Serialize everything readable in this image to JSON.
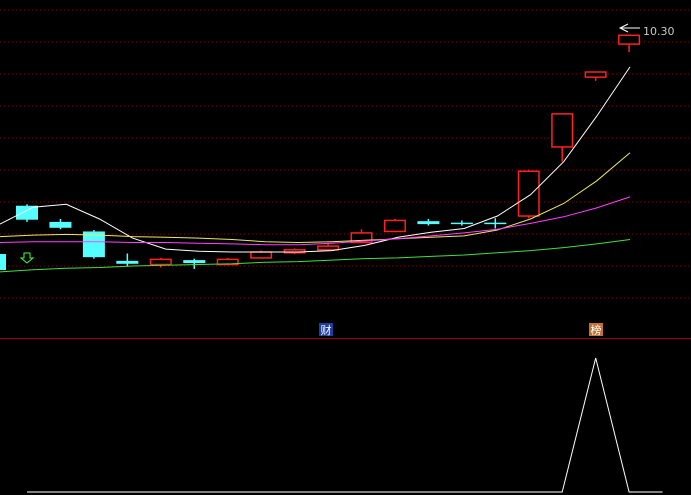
{
  "header": {
    "price_label": "10.30"
  },
  "markers": {
    "finance_badge": "财",
    "ranking_badge": "榜"
  },
  "colors": {
    "background": "#000000",
    "grid": "#8a0000",
    "separator": "#a00000",
    "up_candle": "#ff2020",
    "down_candle": "#55ffff",
    "ma_short": "#ffffff",
    "ma_mid": "#e8e860",
    "ma_long": "#ff40ff",
    "ma_longest": "#40e040",
    "indicator": "#ffffff",
    "signal_arrow": "#40ff40",
    "finance_badge_bg": "#1f3f9f",
    "ranking_badge_bg": "#c07030"
  },
  "icons": {
    "signal": "down-arrow-icon"
  },
  "chart_data": {
    "type": "candlestick",
    "title": "",
    "ylim": [
      6.0,
      10.6
    ],
    "candles": [
      {
        "open": 7.8,
        "close": 7.61,
        "high": 7.82,
        "low": 7.58
      },
      {
        "open": 7.58,
        "close": 7.5,
        "high": 7.62,
        "low": 7.48
      },
      {
        "open": 7.45,
        "close": 7.1,
        "high": 7.47,
        "low": 7.08
      },
      {
        "open": 7.05,
        "close": 7.01,
        "high": 7.15,
        "low": 6.97
      },
      {
        "open": 7.0,
        "close": 7.07,
        "high": 7.09,
        "low": 6.96
      },
      {
        "open": 7.06,
        "close": 7.02,
        "high": 7.08,
        "low": 6.94
      },
      {
        "open": 7.0,
        "close": 7.07,
        "high": 7.09,
        "low": 6.99
      },
      {
        "open": 7.09,
        "close": 7.17,
        "high": 7.19,
        "low": 7.08
      },
      {
        "open": 7.16,
        "close": 7.2,
        "high": 7.22,
        "low": 7.14
      },
      {
        "open": 7.2,
        "close": 7.25,
        "high": 7.29,
        "low": 7.18
      },
      {
        "open": 7.3,
        "close": 7.43,
        "high": 7.48,
        "low": 7.29
      },
      {
        "open": 7.45,
        "close": 7.6,
        "high": 7.62,
        "low": 7.44
      },
      {
        "open": 7.59,
        "close": 7.55,
        "high": 7.62,
        "low": 7.53
      },
      {
        "open": 7.57,
        "close": 7.55,
        "high": 7.6,
        "low": 7.53
      },
      {
        "open": 7.57,
        "close": 7.56,
        "high": 7.63,
        "low": 7.49
      },
      {
        "open": 7.66,
        "close": 8.27,
        "high": 8.29,
        "low": 7.63
      },
      {
        "open": 8.6,
        "close": 9.05,
        "high": 9.05,
        "low": 8.4
      },
      {
        "open": 9.55,
        "close": 9.62,
        "high": 9.62,
        "low": 9.5
      },
      {
        "open": 10.0,
        "close": 10.12,
        "high": 10.12,
        "low": 9.89
      }
    ],
    "moving_averages": [
      {
        "values": [
          7.55,
          7.78,
          7.82,
          7.62,
          7.36,
          7.21,
          7.18,
          7.17,
          7.17,
          7.17,
          7.19,
          7.26,
          7.37,
          7.44,
          7.49,
          7.66,
          7.95,
          8.4,
          9.02,
          9.69
        ]
      },
      {
        "values": [
          7.38,
          7.4,
          7.41,
          7.4,
          7.38,
          7.37,
          7.36,
          7.34,
          7.31,
          7.3,
          7.31,
          7.33,
          7.35,
          7.37,
          7.39,
          7.47,
          7.62,
          7.83,
          8.14,
          8.52
        ]
      },
      {
        "values": [
          7.3,
          7.31,
          7.31,
          7.31,
          7.3,
          7.3,
          7.29,
          7.28,
          7.27,
          7.27,
          7.29,
          7.32,
          7.35,
          7.39,
          7.43,
          7.48,
          7.56,
          7.65,
          7.77,
          7.92
        ]
      },
      {
        "values": [
          6.9,
          6.93,
          6.95,
          6.96,
          6.98,
          6.99,
          7.0,
          7.01,
          7.03,
          7.04,
          7.06,
          7.08,
          7.09,
          7.11,
          7.13,
          7.16,
          7.19,
          7.23,
          7.28,
          7.34
        ]
      }
    ],
    "indicator_values": [
      0,
      0,
      0,
      0,
      0,
      0,
      0,
      0,
      0,
      0,
      0,
      0,
      0,
      0,
      0,
      0,
      0,
      1,
      0,
      0
    ],
    "indicator_ylim": [
      0,
      1
    ]
  }
}
